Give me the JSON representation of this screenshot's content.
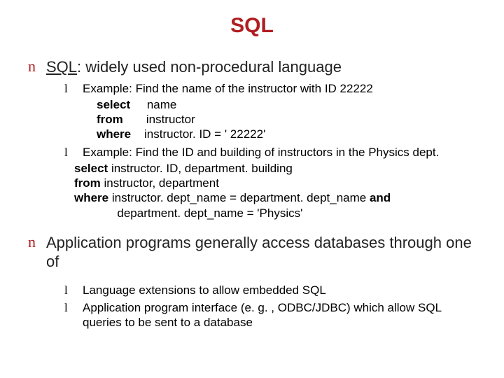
{
  "title": "SQL",
  "section1": {
    "bullet": "n",
    "prefix": "SQL",
    "text": ": widely used non-procedural language",
    "sub1": {
      "bullet": "l",
      "text": "Example: Find the name of the instructor with ID 22222",
      "code": {
        "l1a": "select",
        "l1b": "     name",
        "l2a": "from",
        "l2b": "       instructor",
        "l3a": "where",
        "l3b": "    instructor. ID = ' 22222'"
      }
    },
    "sub2": {
      "bullet": "l",
      "text": "Example: Find the ID and building of instructors in the Physics dept.",
      "code": {
        "l1a": "select ",
        "l1b": "instructor. ID, department. building",
        "l2a": "from ",
        "l2b": "instructor, department",
        "l3a": "where ",
        "l3b": "instructor. dept_name = department. dept_name ",
        "l3c": "and",
        "l4": "             department. dept_name = 'Physics'"
      }
    }
  },
  "section2": {
    "bullet": "n",
    "text": "Application programs generally access databases through one of",
    "sub1": {
      "bullet": "l",
      "text": "Language extensions to allow embedded SQL"
    },
    "sub2": {
      "bullet": "l",
      "text": "Application program interface (e. g. , ODBC/JDBC) which allow SQL queries to be sent to a database"
    }
  }
}
